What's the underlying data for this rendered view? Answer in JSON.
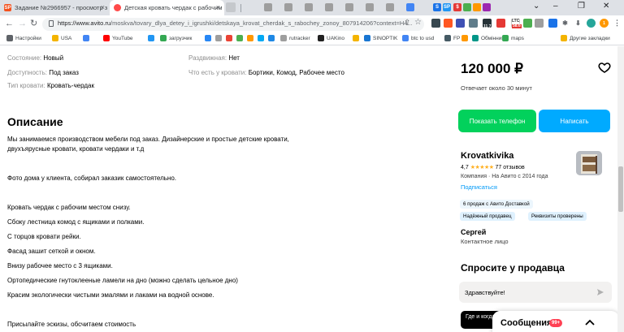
{
  "browser": {
    "tabs": [
      {
        "title": "Задание №2966957 - просмотр з",
        "favicon": "SP",
        "favicon_color": "#f4511e"
      },
      {
        "title": "Детская кровать чердак с рабочим",
        "favicon": "avito",
        "favicon_color": "#ff4a4a"
      }
    ],
    "pinned_tab_icons": [
      "S",
      "SP",
      "$"
    ],
    "url_host": "https://www.avito.ru",
    "url_path": "/moskva/tovary_dlya_detey_i_igrushki/detskaya_krovat_cherdak_s_rabochey_zonoy_807914206?context=H4...",
    "extension_labels": {
      "ltc": "LTC",
      "ltc_value": "58.6",
      "btc_value": "11.7",
      "counter": "1"
    },
    "bookmarks": [
      {
        "label": "Настройки",
        "icon_color": "#5f6368"
      },
      {
        "label": "USA",
        "icon_color": "#f4b400"
      },
      {
        "label": "",
        "icon_color": "#4285f4"
      },
      {
        "label": "YouTube",
        "icon_color": "#ff0000"
      },
      {
        "label": "",
        "icon_color": "#2196f3"
      },
      {
        "label": "загрузчик",
        "icon_color": "#34a853"
      },
      {
        "label": "",
        "icon_color": "#2787f5"
      },
      {
        "label": "",
        "icon_color": "#9e9e9e"
      },
      {
        "label": "",
        "icon_color": "#ea4335"
      },
      {
        "label": "",
        "icon_color": "#4caf50"
      },
      {
        "label": "",
        "icon_color": "#ff9800"
      },
      {
        "label": "",
        "icon_color": "#03a9f4"
      },
      {
        "label": "",
        "icon_color": "#1e88e5"
      },
      {
        "label": "rutracker",
        "icon_color": "#9e9e9e"
      },
      {
        "label": "UAKino",
        "icon_color": "#212121"
      },
      {
        "label": "",
        "icon_color": "#f4b400"
      },
      {
        "label": "SINOPTIK",
        "icon_color": "#1976d2"
      },
      {
        "label": "btc to usd",
        "icon_color": "#4285f4"
      },
      {
        "label": "FP",
        "icon_color": "#455a64"
      },
      {
        "label": "",
        "icon_color": "#ff9800"
      },
      {
        "label": "Обмінник",
        "icon_color": "#009688"
      },
      {
        "label": "maps",
        "icon_color": "#34a853"
      }
    ],
    "other_bookmarks": "Другие закладки"
  },
  "details": {
    "left": [
      {
        "label": "Состояние:",
        "value": "Новый"
      },
      {
        "label": "Доступность:",
        "value": "Под заказ"
      },
      {
        "label": "Тип кровати:",
        "value": "Кровать-чердак"
      }
    ],
    "right": [
      {
        "label": "Раздвижная:",
        "value": "Нет"
      },
      {
        "label": "Что есть у кровати:",
        "value": "Бортики, Комод, Рабочее место"
      }
    ]
  },
  "description": {
    "heading": "Описание",
    "lines": [
      "Мы занимаемся производством мебели под заказ. Дизайнерские и простые детские кровати,",
      "двухъярусные кровати, кровати чердаки и т.д",
      "Фото дома у клиента, собирал заказик самостоятельно.",
      "Кровать чердак с рабочим местом снизу.",
      "Сбоку лестница комод с ящиками и полками.",
      "С торцов кровати рейки.",
      "Фасад зашит сеткой и окном.",
      "Внизу рабочее место с 3 ящиками.",
      "Ортопедические гнутоклееные ламели на дно (можно сделать цельное дно)",
      "Красим экологически чистыми эмалями и лаками на водной основе.",
      "Присылайте эскизы, обсчитаем стоимость"
    ]
  },
  "sidebar": {
    "price": "120 000 ₽",
    "response_time": "Отвечает около 30 минут",
    "phone_button": "Показать телефон",
    "write_button": "Написать",
    "seller": {
      "name": "Krovatkivika",
      "rating": "4,7",
      "stars_count": 5,
      "reviews": "77 отзывов",
      "company_info": "Компания · На Авито с 2014 года",
      "subscribe": "Подписаться",
      "badges": [
        "6 продаж с Авито Доставкой",
        "Надёжный продавец",
        "Реквизиты проверены"
      ]
    },
    "contact_name": "Сергей",
    "contact_role": "Контактное лицо",
    "ask_heading": "Спросите у продавца",
    "message_text": "Здравствуйте!",
    "quick_reply": "Где и когда"
  },
  "messenger": {
    "title": "Сообщения",
    "badge": "99+"
  },
  "colors": {
    "phone_button": "#02d15c",
    "write_button": "#00aaff",
    "link": "#0099f7",
    "badge": "#ff4053"
  }
}
